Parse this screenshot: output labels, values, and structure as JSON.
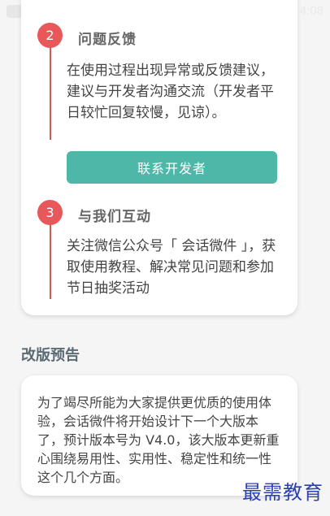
{
  "status_bar": {
    "time": "4:08",
    "icons": [
      "app-icon",
      "wifi-icon",
      "signal-icon",
      "battery-icon"
    ]
  },
  "steps": [
    {
      "number": "2",
      "title": "问题反馈",
      "body": "在使用过程出现异常或反馈建议，建议与开发者沟通交流（开发者平日较忙回复较慢，见谅）。",
      "button_label": "联系开发者"
    },
    {
      "number": "3",
      "title": "与我们互动",
      "body": "关注微信公众号「 会话微件 」，获取使用教程、解决常见问题和参加节日抽奖活动"
    }
  ],
  "notice": {
    "header": "改版预告",
    "body": "为了竭尽所能为大家提供更优质的使用体验，会话微件将开始设计下一个大版本了，预计版本号为 V4.0，该大版本更新重心围绕易用性、实用性、稳定性和统一性这个几个方面。"
  },
  "watermark": "最需教育",
  "colors": {
    "badge": "#e8585b",
    "timeline": "#d35a52",
    "button": "#4fb7a8",
    "section_header": "#5a6b73",
    "watermark": "#2b3fb0"
  }
}
